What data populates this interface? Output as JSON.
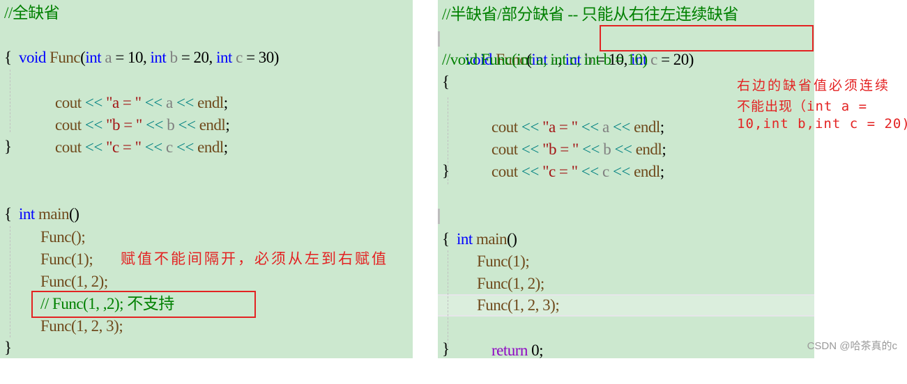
{
  "left_panel": {
    "comment": "//全缺省",
    "signature": {
      "ret": "void",
      "name": "Func",
      "open": "(",
      "p1_type": "int",
      "p1_name": "a",
      "p1_default": " = 10, ",
      "p2_type": "int",
      "p2_name": "b",
      "p2_default": " = 20, ",
      "p3_type": "int",
      "p3_name": "c",
      "p3_default": " = 30)"
    },
    "open_brace": "{",
    "cout_lines": [
      {
        "cout": "cout",
        "op1": " << ",
        "str": "\"a = \"",
        "op2": " << ",
        "var": "a",
        "op3": " << ",
        "endl": "endl",
        "semi": ";"
      },
      {
        "cout": "cout",
        "op1": " << ",
        "str": "\"b = \"",
        "op2": " << ",
        "var": "b",
        "op3": " << ",
        "endl": "endl",
        "semi": ";"
      },
      {
        "cout": "cout",
        "op1": " << ",
        "str": "\"c = \"",
        "op2": " << ",
        "var": "c",
        "op3": " << ",
        "endl": "endl",
        "semi": ";"
      }
    ],
    "close_brace": "}",
    "main_sig": {
      "type": "int",
      "name": "main",
      "parens": "()"
    },
    "main_open": "{",
    "calls": [
      "Func();",
      "Func(1);",
      "Func(1, 2);"
    ],
    "commented_call": "// Func(1, ,2); 不支持",
    "last_call": "Func(1, 2, 3);",
    "main_close": "}",
    "annotation": "赋值不能间隔开，必须从左到右赋值"
  },
  "right_panel": {
    "comment": "//半缺省/部分缺省 -- 只能从右往左连续缺省",
    "signature": {
      "ret": "void",
      "name": "Func",
      "open": "(",
      "p1_type": "int",
      "p1_name": "a",
      "p1_sep": ", ",
      "p2_type": "int",
      "p2_name": "b",
      "p2_default": " = 10, ",
      "p3_type": "int",
      "p3_name": "c",
      "p3_default": " = 20)"
    },
    "alt_signature": "//void Func(int a, int c, int b = 10)",
    "open_brace": "{",
    "cout_lines": [
      {
        "cout": "cout",
        "op1": " << ",
        "str": "\"a = \"",
        "op2": " << ",
        "var": "a",
        "op3": " << ",
        "endl": "endl",
        "semi": ";"
      },
      {
        "cout": "cout",
        "op1": " << ",
        "str": "\"b = \"",
        "op2": " << ",
        "var": "b",
        "op3": " << ",
        "endl": "endl",
        "semi": ";"
      },
      {
        "cout": "cout",
        "op1": " << ",
        "str": "\"c = \"",
        "op2": " << ",
        "var": "c",
        "op3": " << ",
        "endl": "endl",
        "semi": ";"
      }
    ],
    "close_brace": "}",
    "main_sig": {
      "type": "int",
      "name": "main",
      "parens": "()"
    },
    "main_open": "{",
    "calls": [
      "Func(1);",
      "Func(1, 2);",
      "Func(1, 2, 3);"
    ],
    "return_kw": "return",
    "return_val": " 0;",
    "main_close": "}",
    "annotation_lines": [
      "右边的缺省值必须连续",
      "不能出现（int a =",
      "10,int b,int c = 20)"
    ]
  },
  "watermark": "CSDN @哈茶真的c",
  "colors": {
    "background": "#cce8cf",
    "keyword": "#0000ff",
    "function": "#6f4a1c",
    "comment": "#008000",
    "string": "#a31515",
    "annotation": "#e32222",
    "return_keyword": "#8f08c4"
  }
}
